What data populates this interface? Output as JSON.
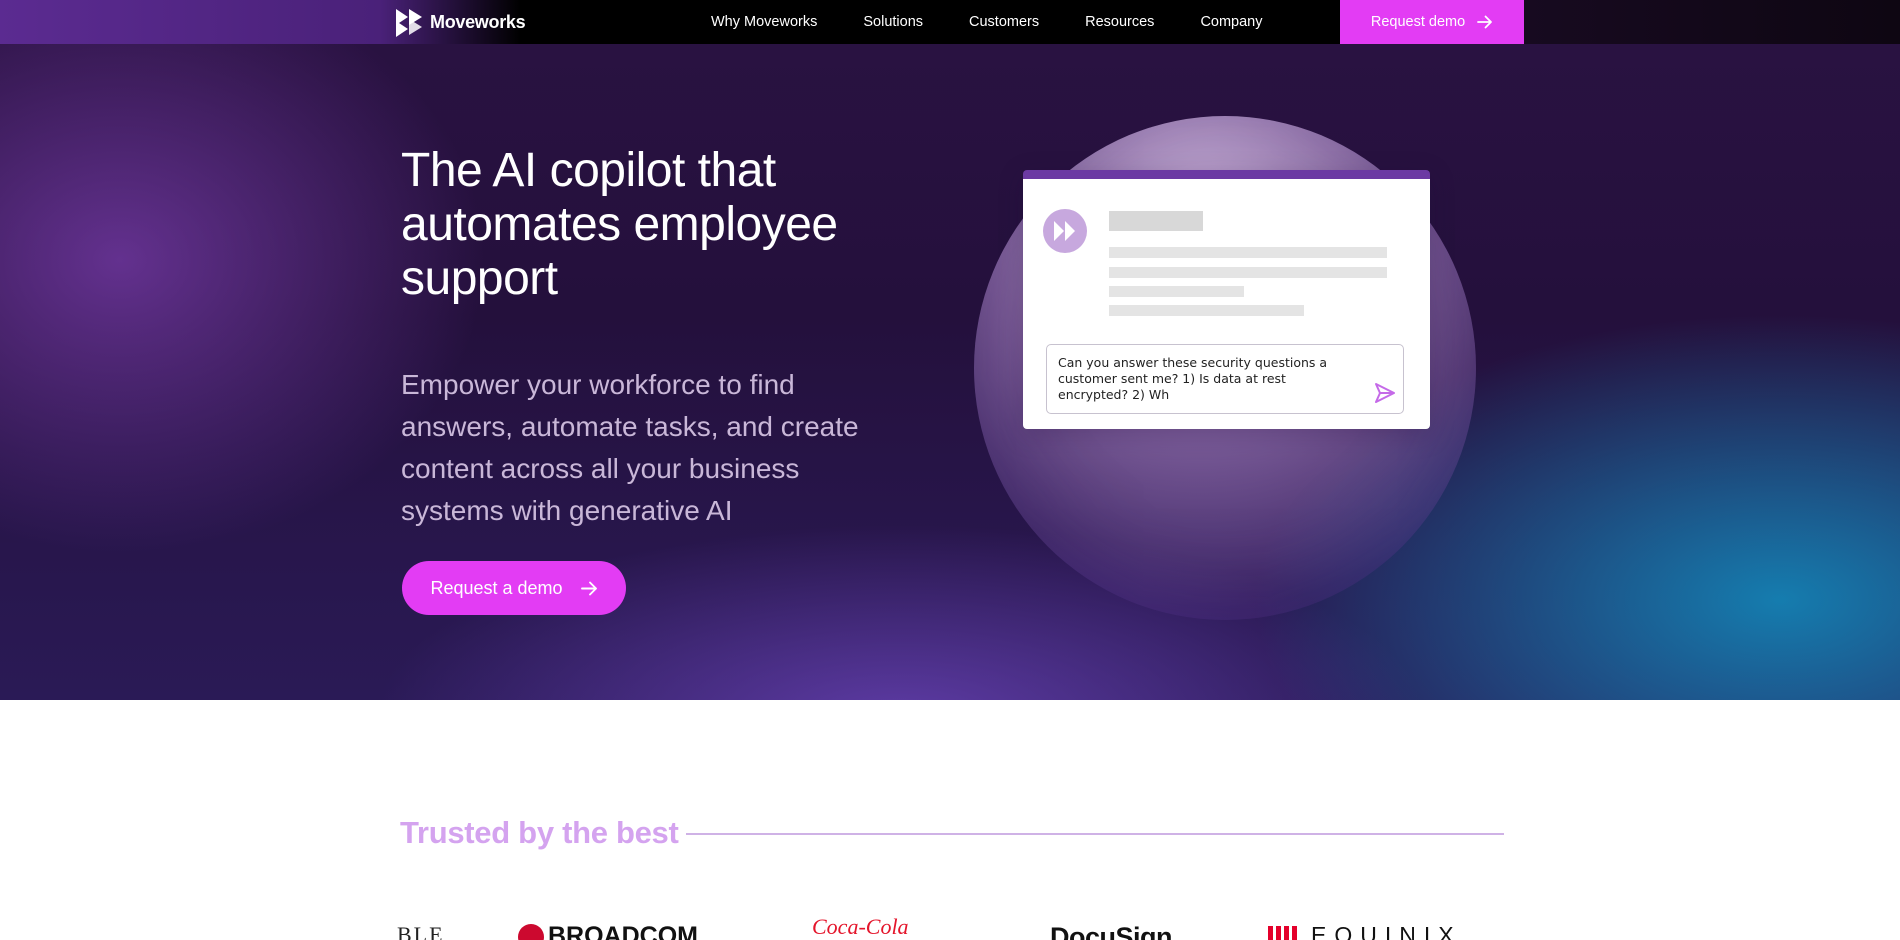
{
  "nav": {
    "brand": "Moveworks",
    "links": [
      "Why Moveworks",
      "Solutions",
      "Customers",
      "Resources",
      "Company"
    ],
    "cta_label": "Request demo"
  },
  "hero": {
    "title": "The AI copilot that automates employee support",
    "subtitle": "Empower your workforce to find answers, automate tasks, and create content across all your business systems with generative AI",
    "cta_label": "Request a demo",
    "chat_input_value": "Can you answer these security questions a customer sent me? 1) Is data at rest encrypted? 2) Wh"
  },
  "trusted": {
    "heading": "Trusted by the best",
    "logos": [
      {
        "name": "partial-logo",
        "text": "BLE"
      },
      {
        "name": "broadcom-logo",
        "text": "BROADCOM"
      },
      {
        "name": "coca-cola-logo",
        "text": "Coca-Cola"
      },
      {
        "name": "docusign-logo",
        "text": "DocuSign"
      },
      {
        "name": "equinix-logo",
        "text": "EQUINIX"
      }
    ]
  },
  "colors": {
    "accent": "#e33cf4",
    "hero_bg": "#24103c",
    "trusted_heading": "#d4a3ef",
    "card_top_bar": "#6c3aa3"
  },
  "icons": {
    "logo": "moveworks-double-chevron-icon",
    "cta_arrow": "arrow-right-icon",
    "send": "send-icon",
    "chat_avatar": "moveworks-avatar-icon"
  }
}
